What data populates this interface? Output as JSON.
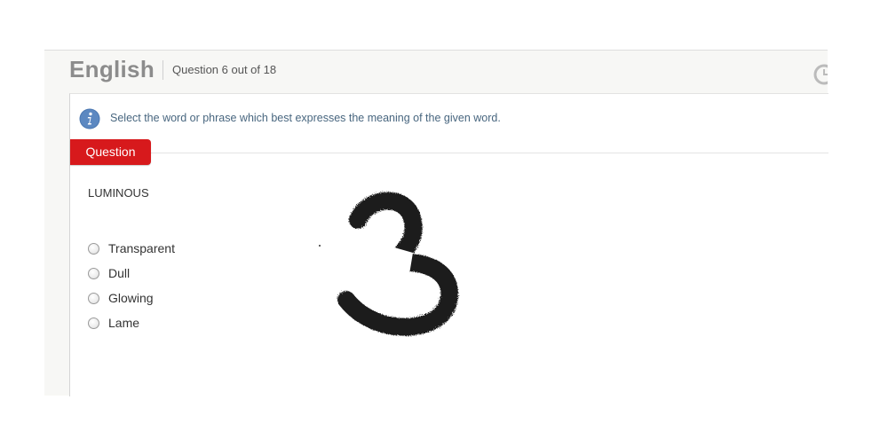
{
  "header": {
    "subject": "English",
    "question_counter": "Question 6 out of 18",
    "timer_icon": "clock-icon"
  },
  "instruction": {
    "icon": "info-icon",
    "text": "Select the word or phrase which best expresses the meaning of the given word."
  },
  "question_tab": {
    "label": "Question",
    "color": "#d7191c"
  },
  "question": {
    "word": "LUMINOUS",
    "options": [
      {
        "label": "Transparent",
        "selected": false
      },
      {
        "label": "Dull",
        "selected": false
      },
      {
        "label": "Glowing",
        "selected": false
      },
      {
        "label": "Lame",
        "selected": false
      }
    ]
  },
  "overlay": {
    "description": "handwritten-digit-3-icon"
  }
}
